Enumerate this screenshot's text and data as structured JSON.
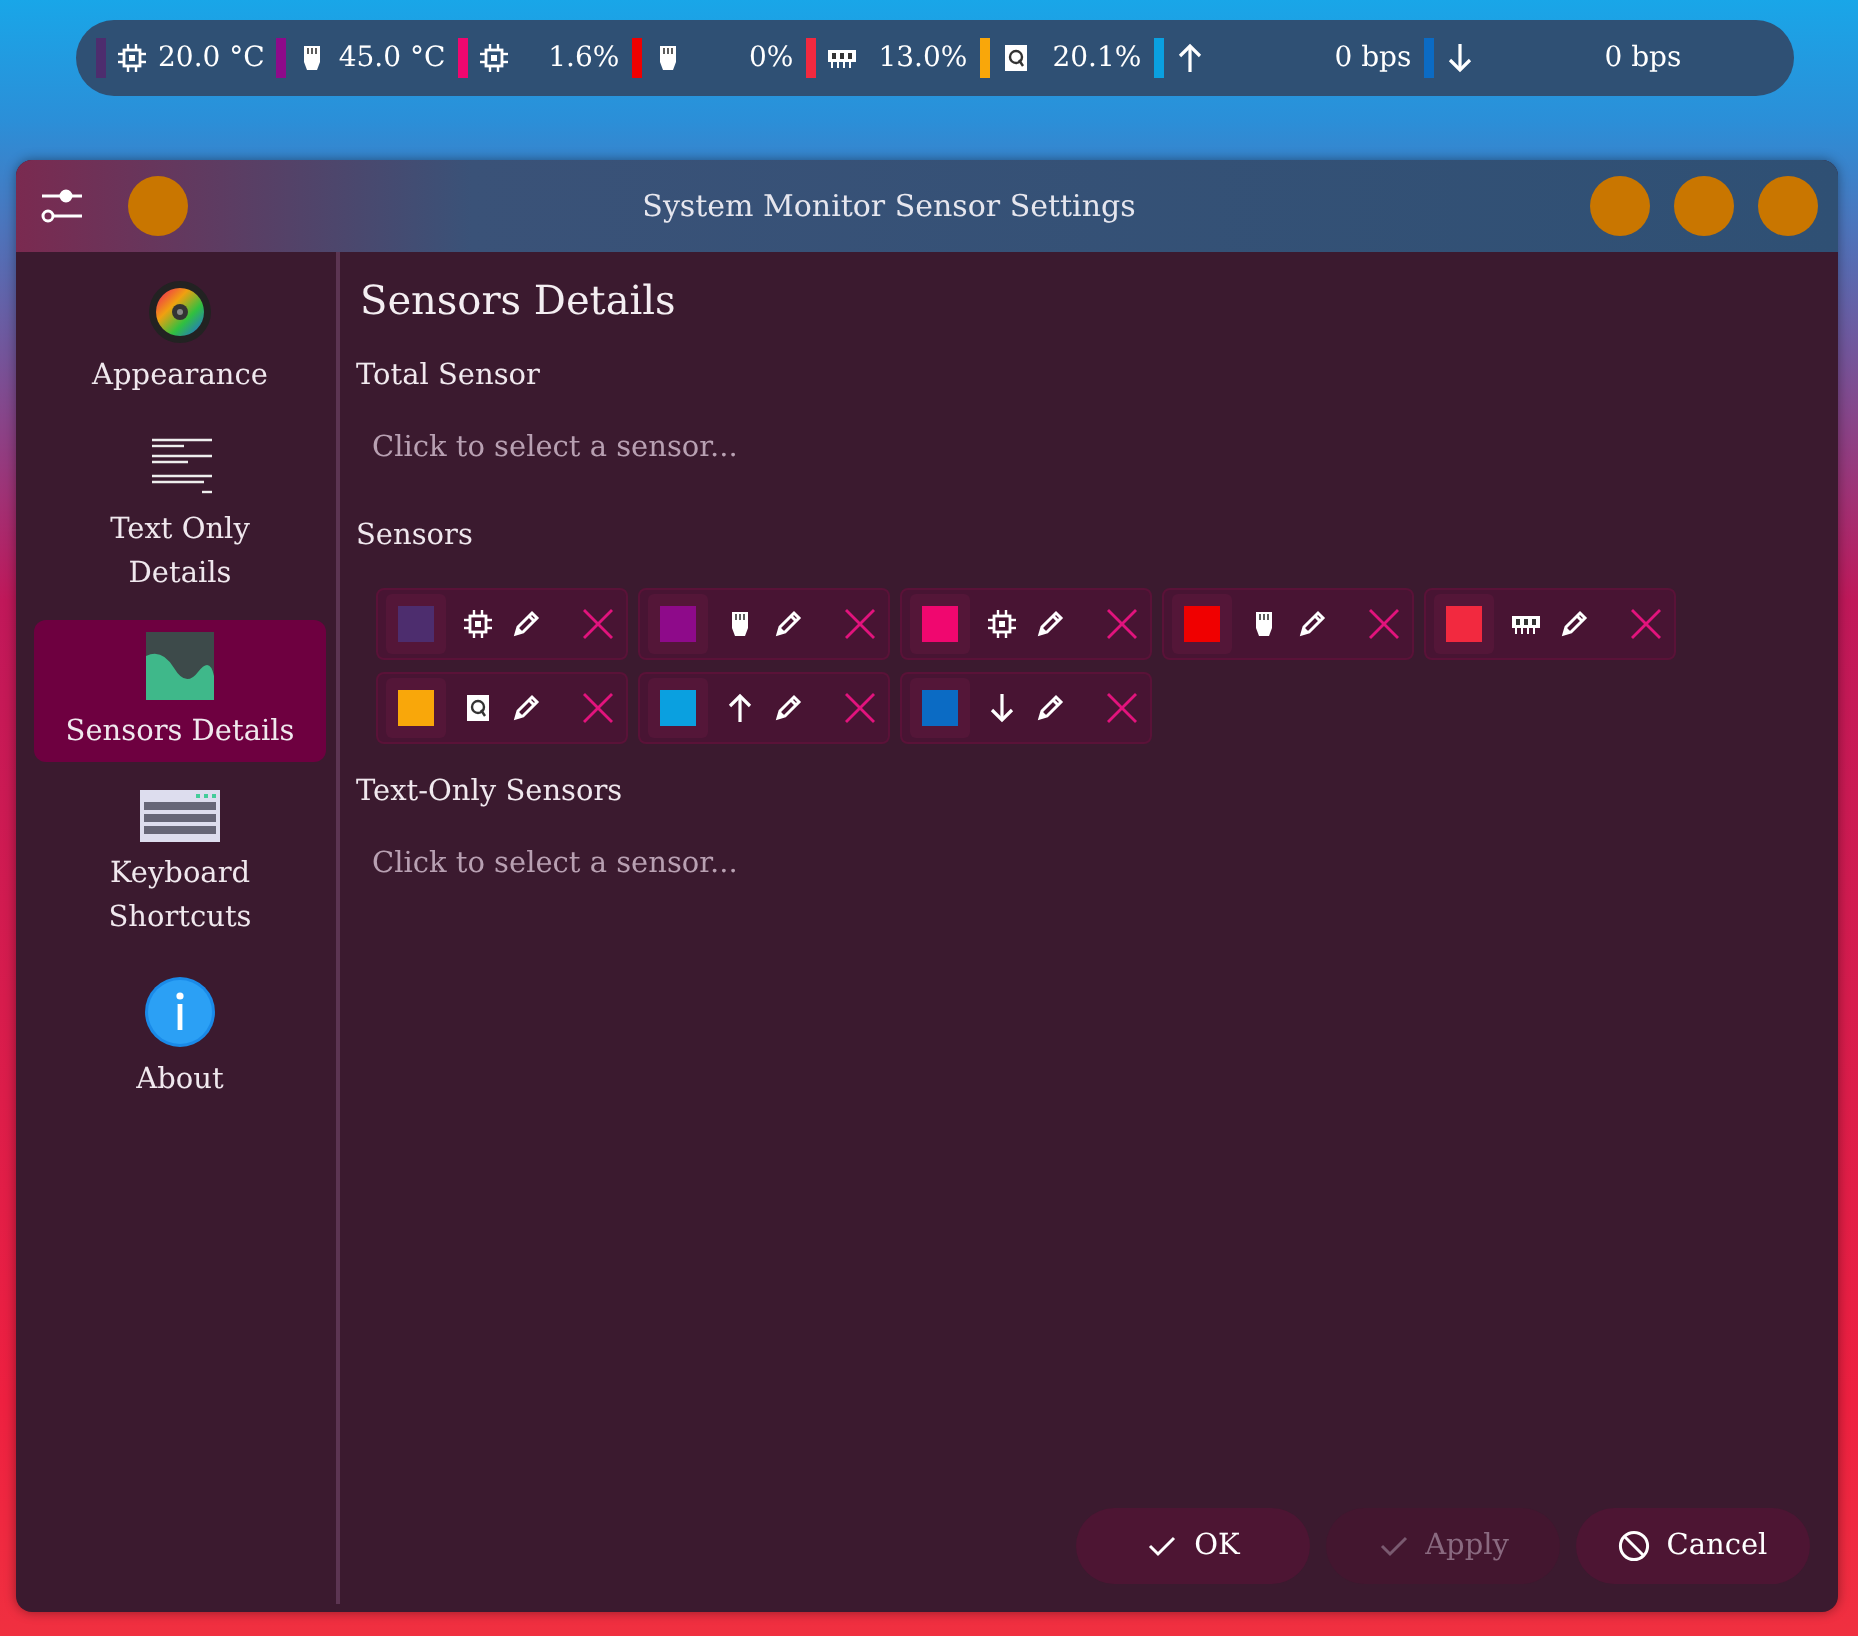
{
  "panel": {
    "items": [
      {
        "color": "#4d2d6e",
        "kind": "cpu",
        "value": "20.0 °C"
      },
      {
        "color": "#8e0a8a",
        "kind": "gpu",
        "value": "45.0 °C"
      },
      {
        "color": "#f0076f",
        "kind": "cpu",
        "value": "1.6%"
      },
      {
        "color": "#f00000",
        "kind": "gpu",
        "value": "0%"
      },
      {
        "color": "#f2293f",
        "kind": "memory",
        "value": "13.0%"
      },
      {
        "color": "#f9a70a",
        "kind": "disk",
        "value": "20.1%"
      },
      {
        "color": "#0aa0e0",
        "kind": "up",
        "value": "0 bps"
      },
      {
        "color": "#0b6bc4",
        "kind": "down",
        "value": "0 bps"
      }
    ]
  },
  "window": {
    "title": "System Monitor Sensor Settings"
  },
  "sidebar": {
    "items": [
      {
        "label": "Appearance",
        "kind": "colors",
        "selected": false
      },
      {
        "label": "Text Only Details",
        "kind": "text",
        "selected": false
      },
      {
        "label": "Sensors Details",
        "kind": "chart",
        "selected": true
      },
      {
        "label": "Keyboard Shortcuts",
        "kind": "keyboard",
        "selected": false
      },
      {
        "label": "About",
        "kind": "info",
        "selected": false
      }
    ]
  },
  "page": {
    "heading": "Sensors Details",
    "total_sensor": {
      "label": "Total Sensor",
      "placeholder": "Click to select a sensor..."
    },
    "sensors": {
      "label": "Sensors",
      "items": [
        {
          "color": "#4d2d6e",
          "kind": "cpu"
        },
        {
          "color": "#8e0a8a",
          "kind": "gpu"
        },
        {
          "color": "#f0076f",
          "kind": "cpu"
        },
        {
          "color": "#f00000",
          "kind": "gpu"
        },
        {
          "color": "#f2293f",
          "kind": "memory"
        },
        {
          "color": "#f9a70a",
          "kind": "disk"
        },
        {
          "color": "#0aa0e0",
          "kind": "up"
        },
        {
          "color": "#0b6bc4",
          "kind": "down"
        }
      ]
    },
    "text_only_sensors": {
      "label": "Text-Only Sensors",
      "placeholder": "Click to select a sensor..."
    }
  },
  "buttons": [
    {
      "label": "OK",
      "kind": "check",
      "disabled": false
    },
    {
      "label": "Apply",
      "kind": "check",
      "disabled": true
    },
    {
      "label": "Cancel",
      "kind": "cancel",
      "disabled": false
    }
  ]
}
